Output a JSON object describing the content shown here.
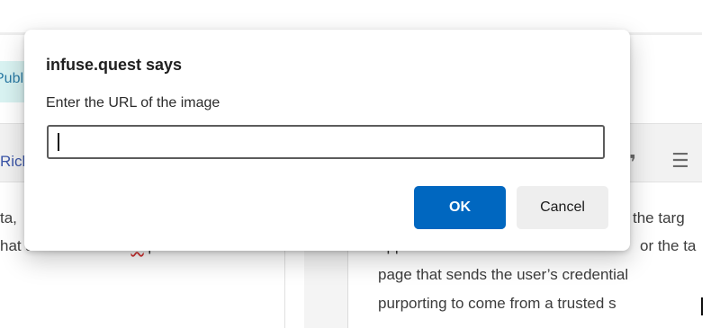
{
  "dialog": {
    "title": "infuse.quest says",
    "message": "Enter the URL of the image",
    "input_value": "",
    "ok_label": "OK",
    "cancel_label": "Cancel",
    "accent_color": "#0067c0"
  },
  "background": {
    "publish_chip_text": "Publish",
    "toolbar_label": "Rich",
    "quote_icon_glyph": "❞",
    "list_icon_glyph": "☰",
    "left_text_line1": "ta,",
    "left_text_line2_a": "hat allows users to ",
    "left_text_line2_err": "to",
    "left_text_line2_b": " pick a",
    "right_text_line1": "the targ",
    "right_text_line2_a": "appearance of the website",
    "right_text_line2_b": "or the ta",
    "right_text_line3": "page that sends the user’s credential",
    "right_text_line4": "purporting to come from a trusted s"
  }
}
